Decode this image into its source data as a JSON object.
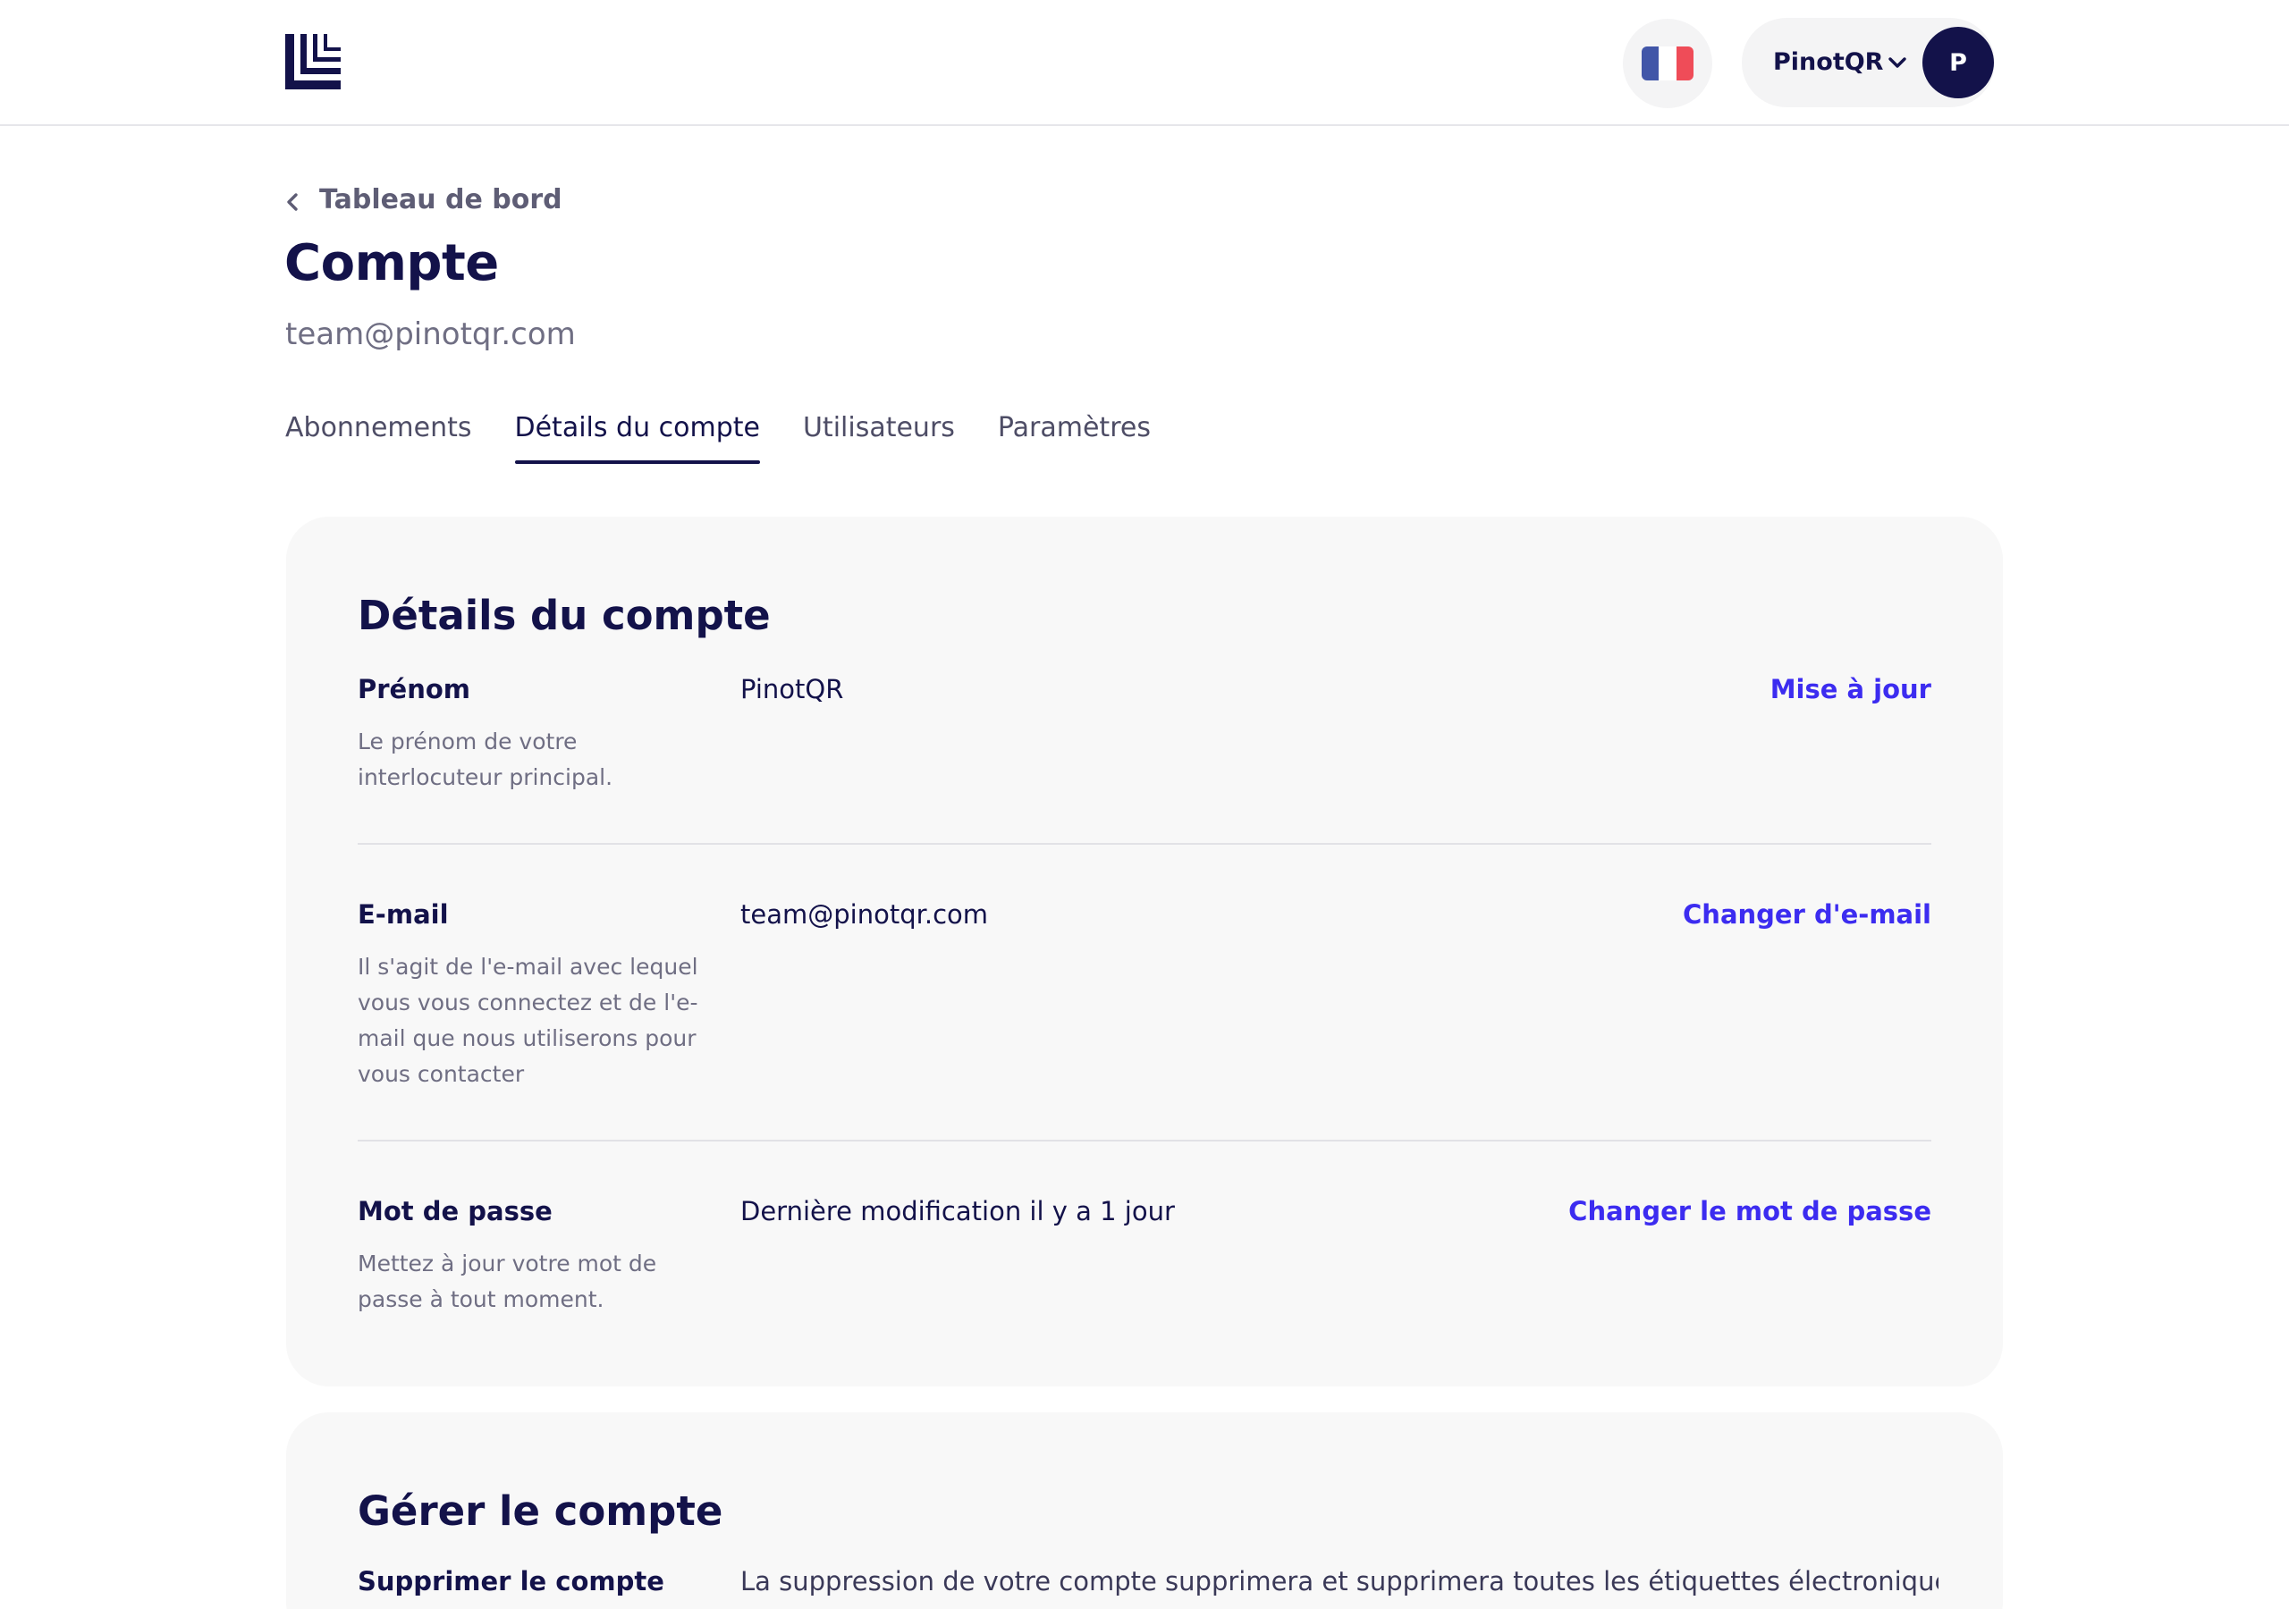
{
  "header": {
    "account_name": "PinotQR",
    "avatar_initial": "P",
    "flag_colors": [
      "#4156a8",
      "#ffffff",
      "#ef4c58"
    ],
    "icons": {
      "logo": "pinotqr-logo-icon",
      "language": "french-flag-icon",
      "account_menu": "chevron-down-icon"
    }
  },
  "breadcrumb": {
    "label": "Tableau de bord",
    "icon": "chevron-left-icon"
  },
  "page": {
    "title": "Compte",
    "subtitle": "team@pinotqr.com"
  },
  "tabs": [
    {
      "label": "Abonnements",
      "active": false
    },
    {
      "label": "Détails du compte",
      "active": true
    },
    {
      "label": "Utilisateurs",
      "active": false
    },
    {
      "label": "Paramètres",
      "active": false
    }
  ],
  "details_card": {
    "title": "Détails du compte",
    "rows": [
      {
        "label": "Prénom",
        "description": "Le prénom de votre interlocuteur principal.",
        "value": "PinotQR",
        "action": "Mise à jour"
      },
      {
        "label": "E-mail",
        "description": "Il s'agit de l'e-mail avec lequel vous vous connectez et de l'e-mail que nous utiliserons pour vous contacter",
        "value": "team@pinotqr.com",
        "action": "Changer d'e-mail"
      },
      {
        "label": "Mot de passe",
        "description": "Mettez à jour votre mot de passe à tout moment.",
        "value": "Dernière modification il y a 1 jour",
        "action": "Changer le mot de passe"
      }
    ]
  },
  "manage_card": {
    "title": "Gérer le compte",
    "rows": [
      {
        "label": "Supprimer le compte",
        "description": "La suppression de votre compte supprimera et supprimera toutes les étiquettes électroniques,"
      }
    ]
  },
  "colors": {
    "primary": "#13124a",
    "accent_link": "#3c2cf0",
    "card_background": "#f8f8f8",
    "muted_text": "#6f6e83"
  }
}
